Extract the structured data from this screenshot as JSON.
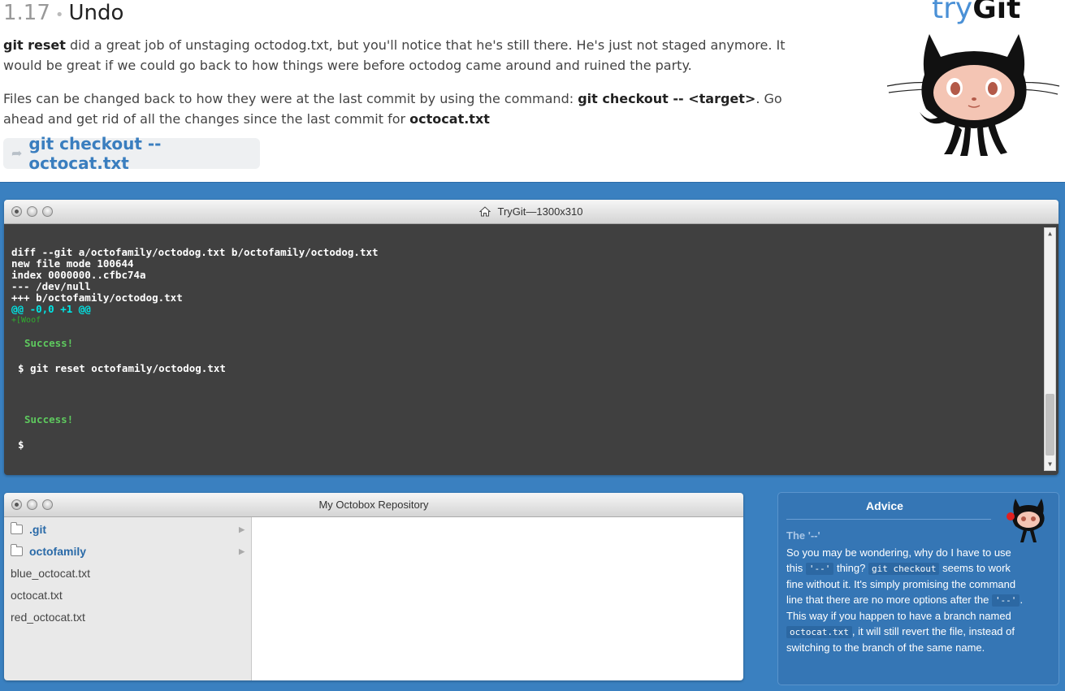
{
  "lesson": {
    "number": "1.17",
    "separator": "•",
    "title": "Undo",
    "p1_bold": "git reset",
    "p1_text": " did a great job of unstaging octodog.txt, but you'll notice that he's still there. He's just not staged anymore. It would be great if we could go back to how things were before octodog came around and ruined the party.",
    "p2_text_a": "Files can be changed back to how they were at the last commit by using the command: ",
    "p2_bold_a": "git checkout -- <target>",
    "p2_text_b": ". Go ahead and get rid of all the changes since the last commit for ",
    "p2_bold_b": "octocat.txt",
    "command": "git checkout -- octocat.txt"
  },
  "logo": {
    "try": "try",
    "git": "Git"
  },
  "terminal": {
    "title": "TryGit—1300x310",
    "lines": [
      "diff --git a/octofamily/octodog.txt b/octofamily/octodog.txt",
      "new file mode 100644",
      "index 0000000..cfbc74a",
      "--- /dev/null",
      "+++ b/octofamily/octodog.txt"
    ],
    "hunk": "@@ -0,0 +1 @@",
    "added_line": "+[Woof",
    "success1": "Success!",
    "prompt_cmd": "$ git reset octofamily/octodog.txt",
    "success2": "Success!",
    "prompt": "$"
  },
  "octobox": {
    "title": "My Octobox Repository",
    "folders": [
      ".git",
      "octofamily"
    ],
    "files": [
      "blue_octocat.txt",
      "octocat.txt",
      "red_octocat.txt"
    ]
  },
  "advice": {
    "title": "Advice",
    "subtitle": "The '--'",
    "t1": "So you may be wondering, why do I have to use this ",
    "c1": "'--'",
    "t2": " thing? ",
    "c2": "git checkout",
    "t3": " seems to work fine without it. It's simply promising the command line that there are no more options after the ",
    "c3": "'--'",
    "t4": ". This way if you happen to have a branch named ",
    "c4": "octocat.txt",
    "t5": ", it will still revert the file, instead of switching to the branch of the same name."
  },
  "colors": {
    "workspace_bg": "#3a80c0",
    "terminal_bg": "#404040",
    "command_link": "#3a7ebf",
    "success_green": "#5ec95e",
    "hunk_cyan": "#00e5e5"
  },
  "icons": [
    "octocat-logo",
    "share-arrow-icon",
    "home-icon",
    "folder-icon",
    "chevron-right-icon",
    "window-control-icon"
  ]
}
